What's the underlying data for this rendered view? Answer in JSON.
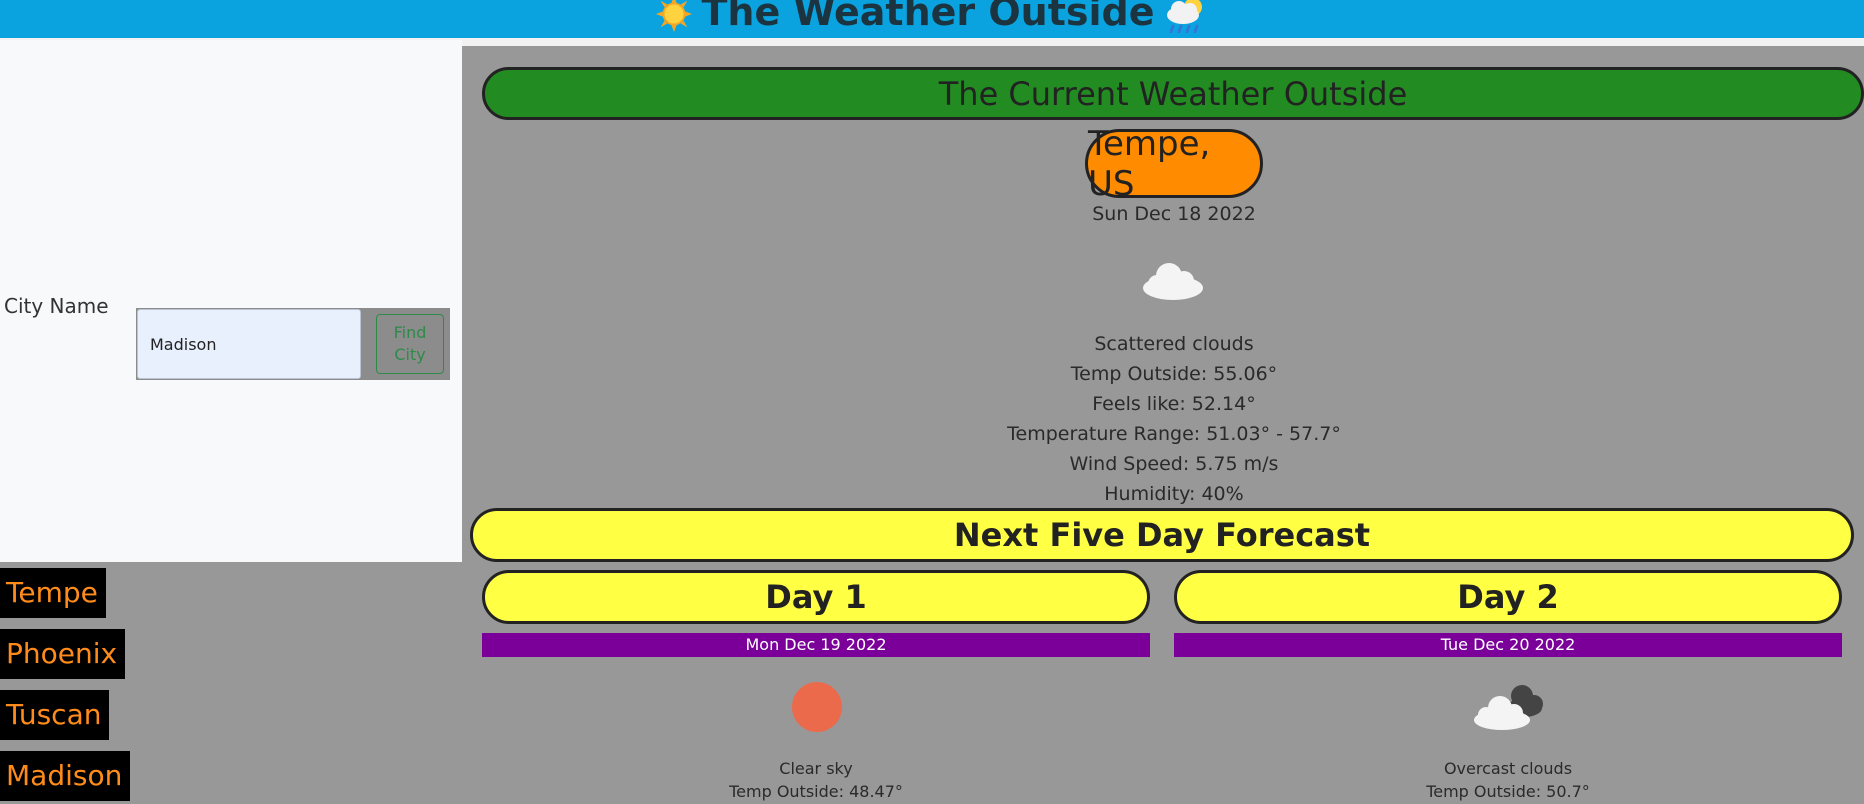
{
  "header": {
    "title": "The Weather Outside"
  },
  "search": {
    "label": "City Name",
    "value": "Madison",
    "button_label": "Find City"
  },
  "history": [
    "Tempe",
    "Phoenix",
    "Tuscan",
    "Madison"
  ],
  "current": {
    "heading": "The Current Weather Outside",
    "location": "Tempe, US",
    "date": "Sun Dec 18 2022",
    "icon": "cloud-icon",
    "description": "Scattered clouds",
    "temp": "Temp Outside: 55.06°",
    "feels_like": "Feels like: 52.14°",
    "range": "Temperature Range: 51.03° - 57.7°",
    "wind": "Wind Speed: 5.75 m/s",
    "humidity": "Humidity: 40%"
  },
  "forecast": {
    "heading": "Next Five Day Forecast",
    "days": [
      {
        "label": "Day 1",
        "date": "Mon Dec 19 2022",
        "icon": "sun-circle-icon",
        "description": "Clear sky",
        "temp": "Temp Outside: 48.47°"
      },
      {
        "label": "Day 2",
        "date": "Tue Dec 20 2022",
        "icon": "overcast-clouds-icon",
        "description": "Overcast clouds",
        "temp": "Temp Outside: 50.7°"
      }
    ]
  },
  "colors": {
    "topbar": "#0aa3e0",
    "current_header": "#228b22",
    "city_pill": "#ff8c00",
    "forecast_pill": "#ffff44",
    "date_bar": "#7a0099",
    "history_text": "#ff8c1a"
  }
}
